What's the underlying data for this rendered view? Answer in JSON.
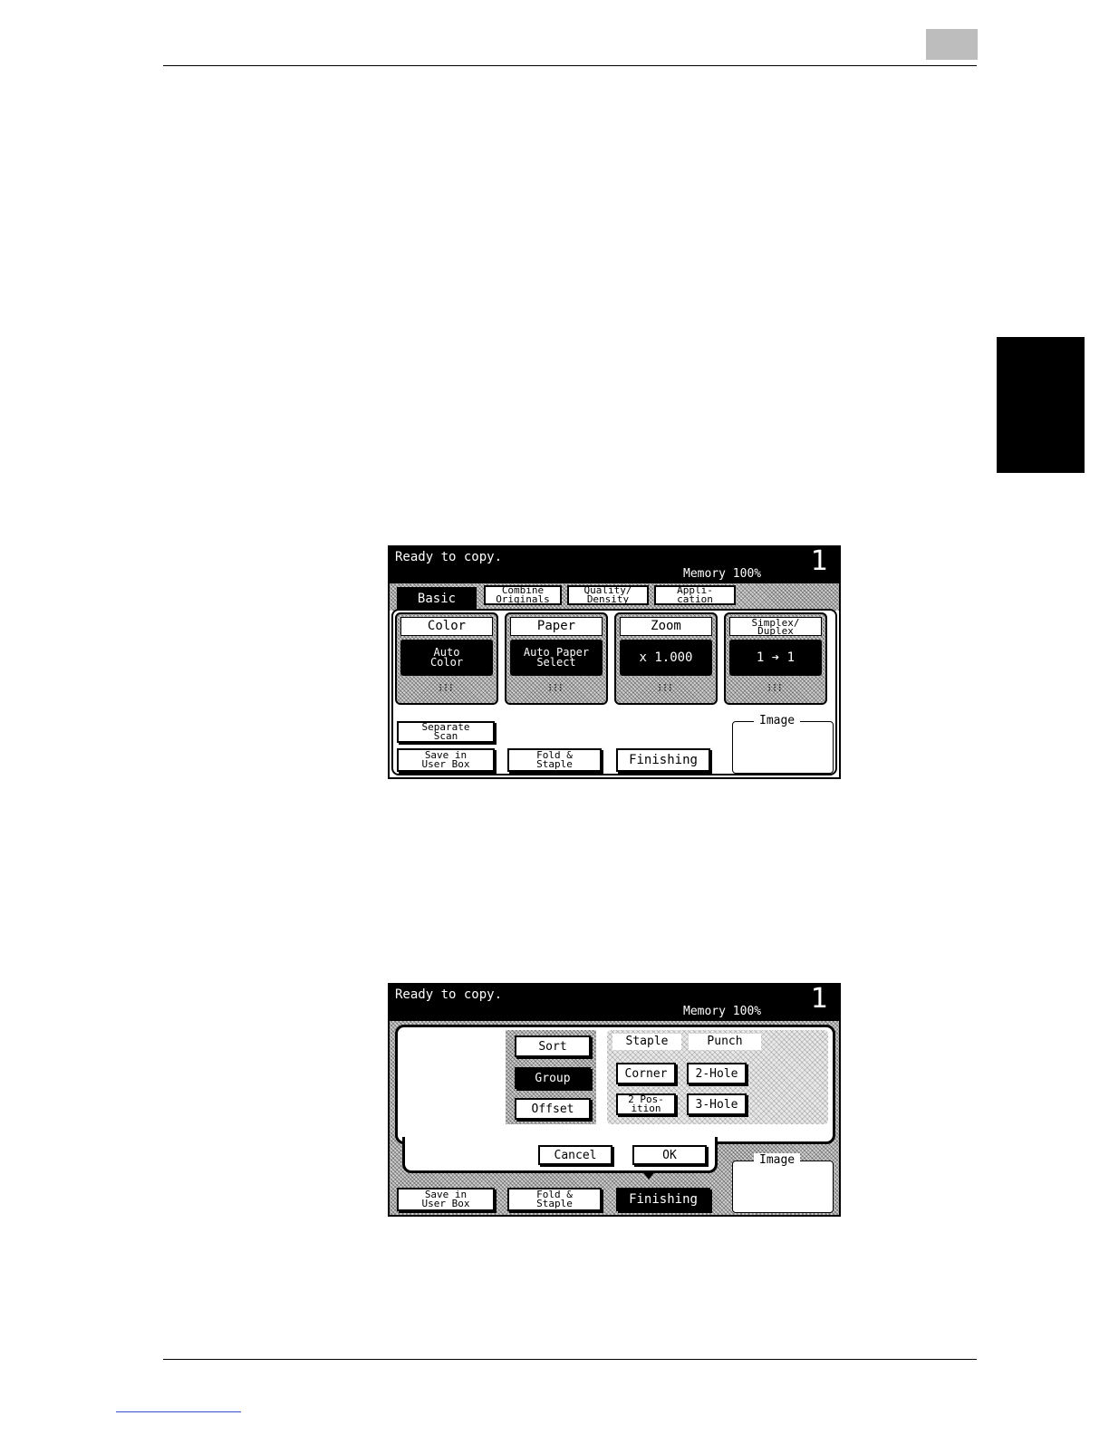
{
  "screen1": {
    "status": {
      "message": "Ready to copy.",
      "memory": "Memory  100%",
      "count": "1"
    },
    "tabs": [
      {
        "label": "Basic"
      },
      {
        "label": "Combine\nOriginals"
      },
      {
        "label": "Quality/\nDensity"
      },
      {
        "label": "Appli-\ncation"
      }
    ],
    "cards": [
      {
        "title": "Color",
        "value": "Auto\nColor"
      },
      {
        "title": "Paper",
        "value": "Auto Paper\nSelect"
      },
      {
        "title": "Zoom",
        "value": "x 1.000"
      },
      {
        "title": "Simplex/\nDuplex",
        "value": "1 ➔ 1"
      }
    ],
    "buttons": {
      "separate_scan": "Separate\nScan",
      "save_in_user_box": "Save in\nUser Box",
      "fold_staple": "Fold &\nStaple",
      "finishing": "Finishing"
    },
    "image_label": "Image"
  },
  "screen2": {
    "status": {
      "message": "Ready to copy.",
      "memory": "Memory  100%",
      "count": "1"
    },
    "sort_options": [
      "Sort",
      "Group",
      "Offset"
    ],
    "selected_sort": "Group",
    "staple_label": "Staple",
    "punch_label": "Punch",
    "staple_options": [
      "Corner",
      "2 Pos-\nition"
    ],
    "punch_options": [
      "2-Hole",
      "3-Hole"
    ],
    "cancel": "Cancel",
    "ok": "OK",
    "buttons": {
      "save_in_user_box": "Save in\nUser Box",
      "fold_staple": "Fold &\nStaple",
      "finishing": "Finishing"
    },
    "image_label": "Image"
  }
}
